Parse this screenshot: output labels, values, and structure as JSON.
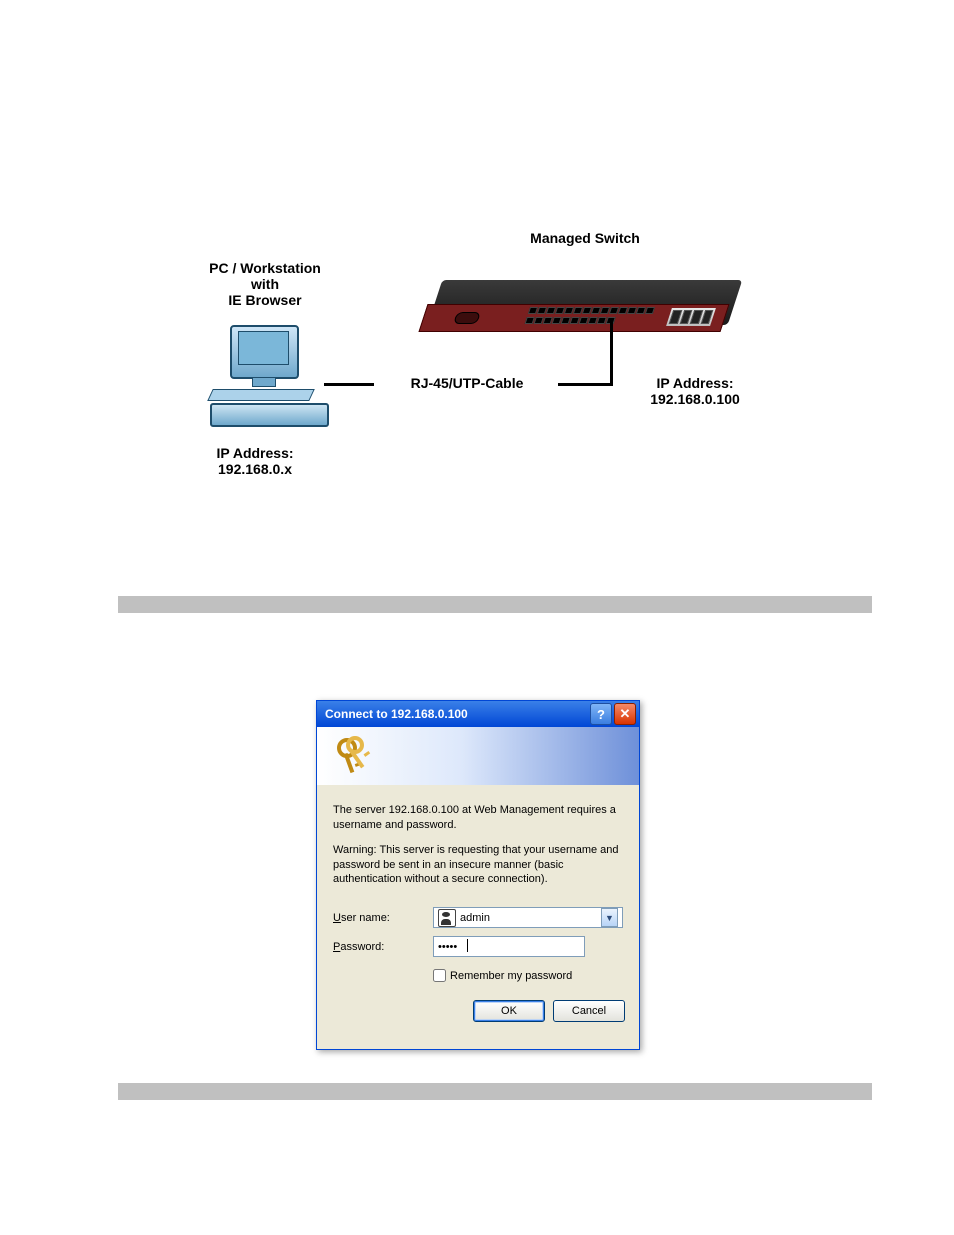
{
  "diagram": {
    "pc_label": "PC / Workstation\nwith\nIE Browser",
    "switch_label": "Managed Switch",
    "cable_label": "RJ-45/UTP-Cable",
    "pc_ip_label": "IP Address:\n192.168.0.x",
    "switch_ip_label": "IP Address:\n192.168.0.100"
  },
  "dialog": {
    "title": "Connect to 192.168.0.100",
    "help_symbol": "?",
    "close_symbol": "✕",
    "message1": "The server 192.168.0.100 at Web Management requires a username and password.",
    "message2": "Warning: This server is requesting that your username and password be sent in an insecure manner (basic authentication without a secure connection).",
    "username_label_pre": "U",
    "username_label_post": "ser name:",
    "password_label_pre": "P",
    "password_label_post": "assword:",
    "username_value": "admin",
    "password_value": "•••••",
    "remember_pre": "R",
    "remember_post": "emember my password",
    "ok_label": "OK",
    "cancel_label": "Cancel"
  }
}
